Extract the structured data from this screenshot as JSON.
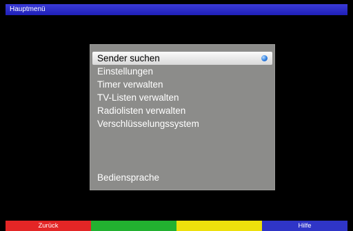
{
  "title": "Hauptmenü",
  "menu": {
    "items": [
      {
        "label": "Sender suchen",
        "selected": true,
        "icon": "blue-dot-icon"
      },
      {
        "label": "Einstellungen"
      },
      {
        "label": "Timer verwalten"
      },
      {
        "label": "TV-Listen verwalten"
      },
      {
        "label": "Radiolisten verwalten"
      },
      {
        "label": "Verschlüsselungssystem"
      }
    ],
    "bottom_item": "Bediensprache"
  },
  "footer": {
    "keys": [
      {
        "label": "Zurück",
        "color": "#e32626"
      },
      {
        "label": "",
        "color": "#22b130"
      },
      {
        "label": "",
        "color": "#ede00c"
      },
      {
        "label": "Hilfe",
        "color": "#2f35c7"
      }
    ]
  },
  "colors": {
    "title_bar": "#2b2bcc",
    "panel": "#8c8c8a",
    "background": "#000000"
  }
}
